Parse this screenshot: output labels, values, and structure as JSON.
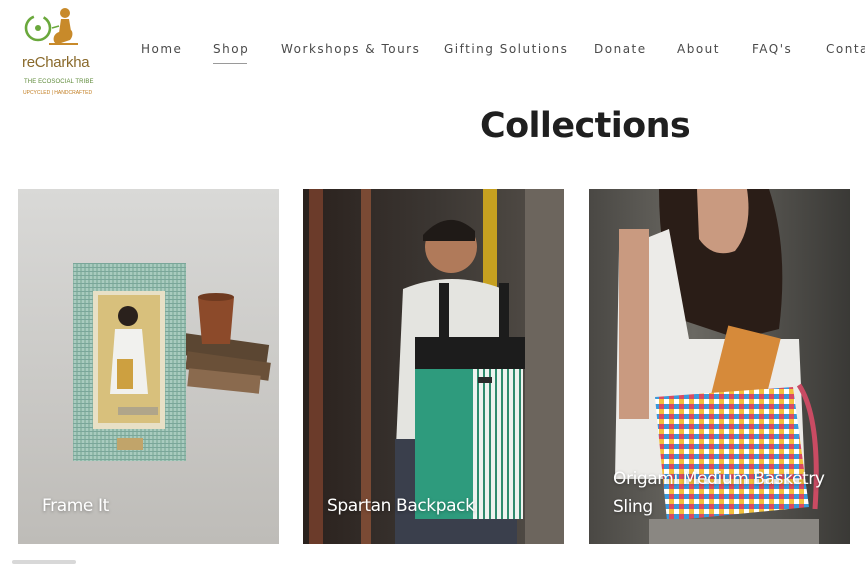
{
  "brand": {
    "name": "reCharkha",
    "tagline": "THE ECOSOCIAL TRIBE",
    "subtag": "UPCYCLED | HANDCRAFTED",
    "icon": "charkha-logo-icon",
    "color_primary": "#8a6a2c",
    "color_green": "#5f8b3b"
  },
  "nav": {
    "items": [
      "Home",
      "Shop",
      "Workshops & Tours",
      "Gifting Solutions",
      "Donate",
      "About",
      "FAQ's",
      "Contact"
    ],
    "active": "Shop"
  },
  "page": {
    "title": "Collections"
  },
  "collections": [
    {
      "label": "Frame It",
      "image": "photo-frame-image"
    },
    {
      "label": "Spartan Backpack",
      "image": "backpack-image"
    },
    {
      "label_line1": "Origami Medium Basketry",
      "label_line2": "Sling",
      "image": "sling-bag-image"
    }
  ]
}
